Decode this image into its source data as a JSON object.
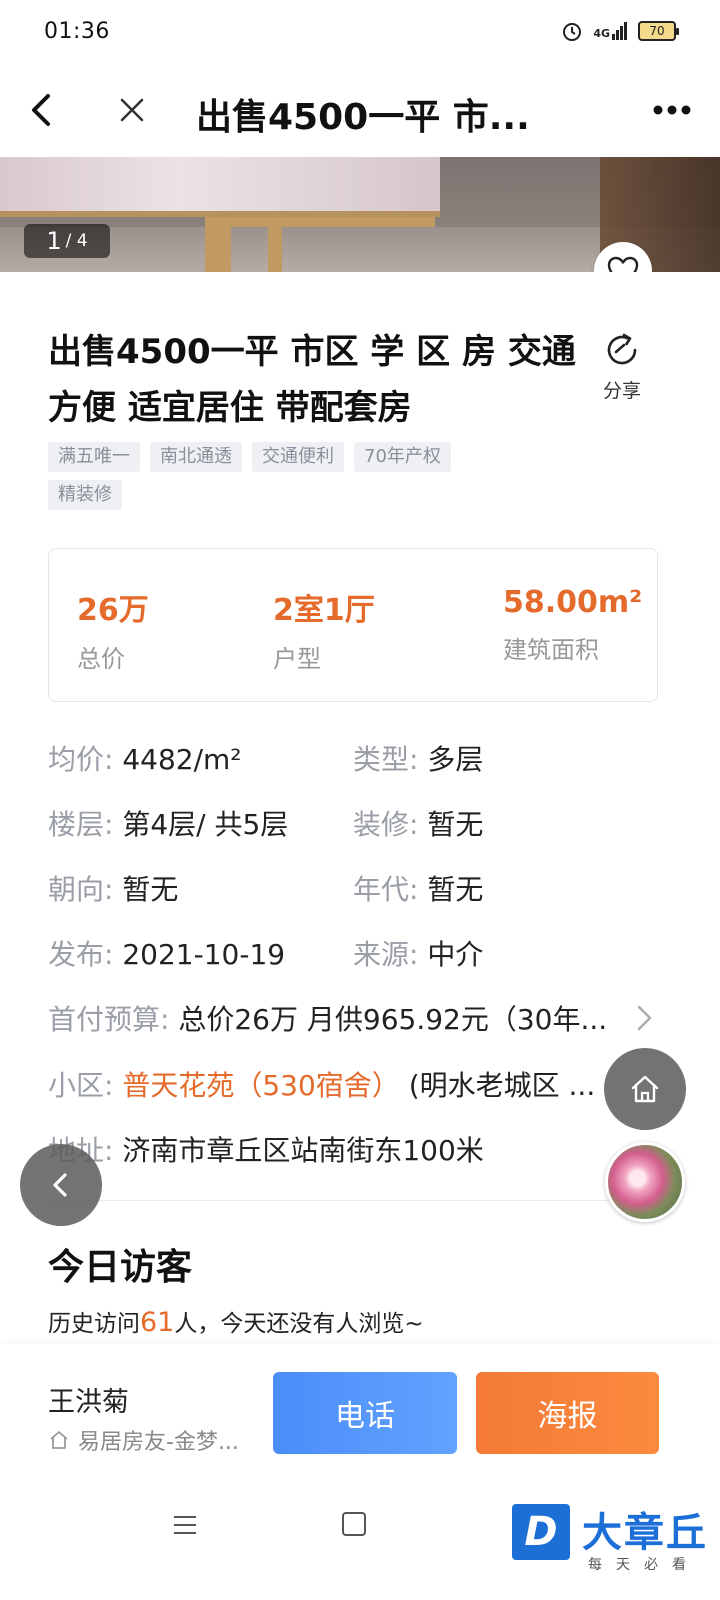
{
  "status_bar": {
    "time": "01:36",
    "network": "4G",
    "battery": "70"
  },
  "nav": {
    "title": "出售4500一平 市..."
  },
  "gallery": {
    "current": "1",
    "total": "/ 4"
  },
  "listing": {
    "title": "出售4500一平 市区 学 区 房 交通方便 适宜居住 带配套房",
    "share_label": "分享",
    "tags": [
      "满五唯一",
      "南北通透",
      "交通便利",
      "70年产权",
      "精装修"
    ]
  },
  "summary": {
    "price_value": "26万",
    "price_label": "总价",
    "layout_value": "2室1厅",
    "layout_label": "户型",
    "area_value": "58.00m²",
    "area_label": "建筑面积"
  },
  "details": {
    "unit_price_label": "均价:",
    "unit_price_value": "4482/m²",
    "type_label": "类型:",
    "type_value": "多层",
    "floor_label": "楼层:",
    "floor_value": "第4层/ 共5层",
    "decoration_label": "装修:",
    "decoration_value": "暂无",
    "orientation_label": "朝向:",
    "orientation_value": "暂无",
    "era_label": "年代:",
    "era_value": "暂无",
    "publish_label": "发布:",
    "publish_value": "2021-10-19",
    "source_label": "来源:",
    "source_value": "中介",
    "downpay_label": "首付预算:",
    "downpay_value": "总价26万 月供965.92元（30年...",
    "community_label": "小区:",
    "community_name": "普天花苑（530宿舍）",
    "community_district": "(明水老城区 ...",
    "address_label": "地址:",
    "address_value": "济南市章丘区站南街东100米"
  },
  "visitors": {
    "section_title": "今日访客",
    "prefix": "历史访问",
    "count": "61",
    "suffix": "人，今天还没有人浏览~"
  },
  "agent": {
    "name": "王洪菊",
    "company": "易居房友-金梦..."
  },
  "actions": {
    "call_label": "电话",
    "poster_label": "海报"
  },
  "watermark": {
    "logo_letter": "D",
    "brand": "大章丘",
    "slogan": "每天必看"
  },
  "colors": {
    "accent_orange": "#e46b2b",
    "call_blue": "#4a8df8",
    "poster_orange": "#f47a36",
    "brand_blue": "#1d6fd8"
  }
}
